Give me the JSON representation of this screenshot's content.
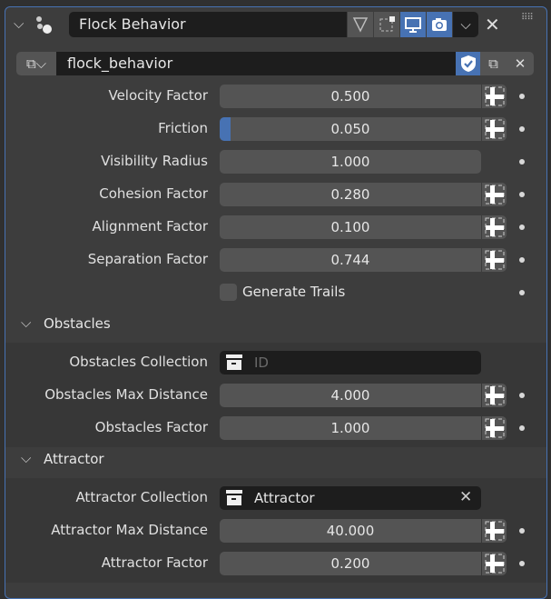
{
  "header": {
    "name": "Flock Behavior",
    "toggles": [
      {
        "icon": "edit-mode-icon",
        "on": false
      },
      {
        "icon": "cage-icon",
        "on": false
      },
      {
        "icon": "viewport-icon",
        "on": true
      },
      {
        "icon": "render-camera-icon",
        "on": true
      }
    ]
  },
  "node_group": {
    "name": "flock_behavior"
  },
  "main_rows": [
    {
      "label": "Velocity Factor",
      "value": "0.500",
      "socket": true
    },
    {
      "label": "Friction",
      "value": "0.050",
      "socket": true,
      "fill": 0.04
    },
    {
      "label": "Visibility Radius",
      "value": "1.000",
      "socket": false
    },
    {
      "label": "Cohesion Factor",
      "value": "0.280",
      "socket": true
    },
    {
      "label": "Alignment Factor",
      "value": "0.100",
      "socket": true
    },
    {
      "label": "Separation Factor",
      "value": "0.744",
      "socket": true
    }
  ],
  "checkbox": {
    "label": "Generate Trails",
    "checked": false
  },
  "obstacles": {
    "title": "Obstacles",
    "collection_label": "Obstacles Collection",
    "collection_placeholder": "ID",
    "rows": [
      {
        "label": "Obstacles Max Distance",
        "value": "4.000"
      },
      {
        "label": "Obstacles Factor",
        "value": "1.000"
      }
    ]
  },
  "attractor": {
    "title": "Attractor",
    "collection_label": "Attractor Collection",
    "collection_value": "Attractor",
    "rows": [
      {
        "label": "Attractor Max Distance",
        "value": "40.000"
      },
      {
        "label": "Attractor Factor",
        "value": "0.200"
      }
    ]
  },
  "colors": {
    "accent": "#4772b3"
  }
}
